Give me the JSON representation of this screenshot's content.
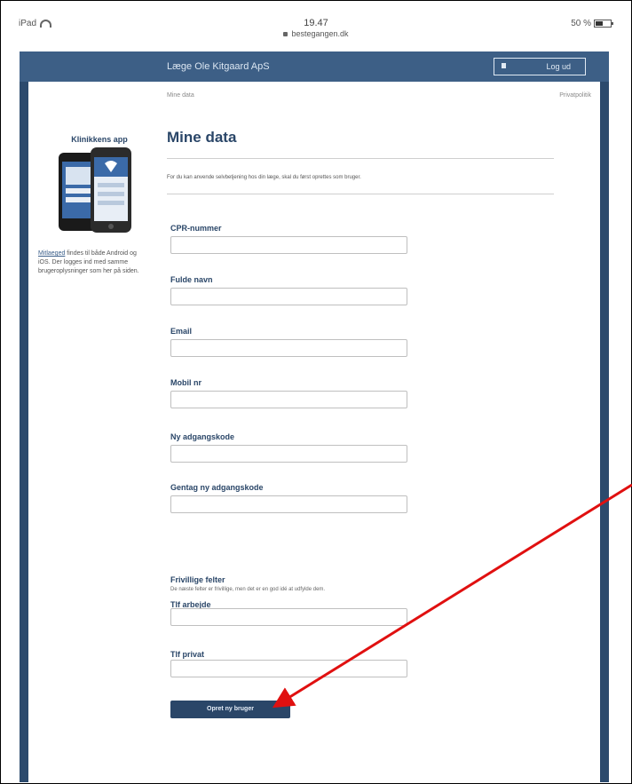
{
  "status": {
    "device": "iPad",
    "time": "19.47",
    "url": "bestegangen.dk",
    "battery": "50 %"
  },
  "header": {
    "brand": "Læge Ole Kitgaard ApS",
    "logout_label": "Log ud"
  },
  "breadcrumb": {
    "left": "Mine data",
    "right": "Privatpolitik"
  },
  "sidebar": {
    "title": "Klinikkens app",
    "link_label": "Mitlaeged",
    "text": " findes til både Android og iOS. Der logges ind med samme brugeroplysninger som her på siden."
  },
  "main": {
    "title": "Mine data",
    "intro": "For du kan anvende selvbetjening hos din læge, skal du først oprettes som bruger.",
    "fields": [
      {
        "label": "CPR-nummer",
        "value": ""
      },
      {
        "label": "Fulde navn",
        "value": ""
      },
      {
        "label": "Email",
        "value": ""
      },
      {
        "label": "Mobil nr",
        "value": ""
      },
      {
        "label": "Ny adgangskode",
        "value": ""
      },
      {
        "label": "Gentag ny adgangskode",
        "value": ""
      }
    ],
    "optional_title": "Frivillige felter",
    "optional_text": "De næste felter er frivillige, men det er en god idé at udfylde dem.",
    "optional_fields": [
      {
        "label": "Tlf arbejde",
        "value": ""
      },
      {
        "label": "Tlf privat",
        "value": ""
      }
    ],
    "submit_label": "Opret ny bruger"
  },
  "colors": {
    "brand_dark": "#2a4668",
    "topbar": "#3d5f86",
    "arrow": "#e01010"
  }
}
